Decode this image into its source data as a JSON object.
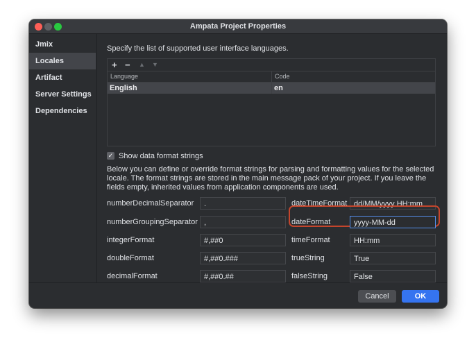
{
  "window": {
    "title": "Ampata Project Properties"
  },
  "sidebar": {
    "items": [
      {
        "label": "Jmix"
      },
      {
        "label": "Locales"
      },
      {
        "label": "Artifact"
      },
      {
        "label": "Server Settings"
      },
      {
        "label": "Dependencies"
      }
    ],
    "selected": "Locales"
  },
  "locales": {
    "description": "Specify the list of supported user interface languages.",
    "toolbar": {
      "add": "+",
      "remove": "−",
      "up": "▲",
      "down": "▼"
    },
    "table": {
      "columns": [
        "Language",
        "Code"
      ],
      "rows": [
        {
          "language": "English",
          "code": "en"
        }
      ]
    },
    "show_format_strings": {
      "label": "Show data format strings",
      "checked": true
    },
    "paragraph": "Below you can define or override format strings for parsing and formatting values for the selected locale. The format strings are stored in the main message pack of your project. If you leave the fields empty, inherited values from application components are used.",
    "formats": {
      "numberDecimalSeparator": {
        "label": "numberDecimalSeparator",
        "value": "."
      },
      "numberGroupingSeparator": {
        "label": "numberGroupingSeparator",
        "value": ","
      },
      "integerFormat": {
        "label": "integerFormat",
        "value": "#,##0"
      },
      "doubleFormat": {
        "label": "doubleFormat",
        "value": "#,##0.###"
      },
      "decimalFormat": {
        "label": "decimalFormat",
        "value": "#,##0.##"
      },
      "dateTimeFormat": {
        "label": "dateTimeFormat",
        "value": "dd/MM/yyyy HH:mm"
      },
      "dateFormat": {
        "label": "dateFormat",
        "value": "yyyy-MM-dd"
      },
      "timeFormat": {
        "label": "timeFormat",
        "value": "HH:mm"
      },
      "trueString": {
        "label": "trueString",
        "value": "True"
      },
      "falseString": {
        "label": "falseString",
        "value": "False"
      }
    }
  },
  "footer": {
    "cancel": "Cancel",
    "ok": "OK"
  },
  "colors": {
    "window_bg": "#2b2d30",
    "accent": "#3574f0",
    "highlight_ring": "#c4452c"
  }
}
